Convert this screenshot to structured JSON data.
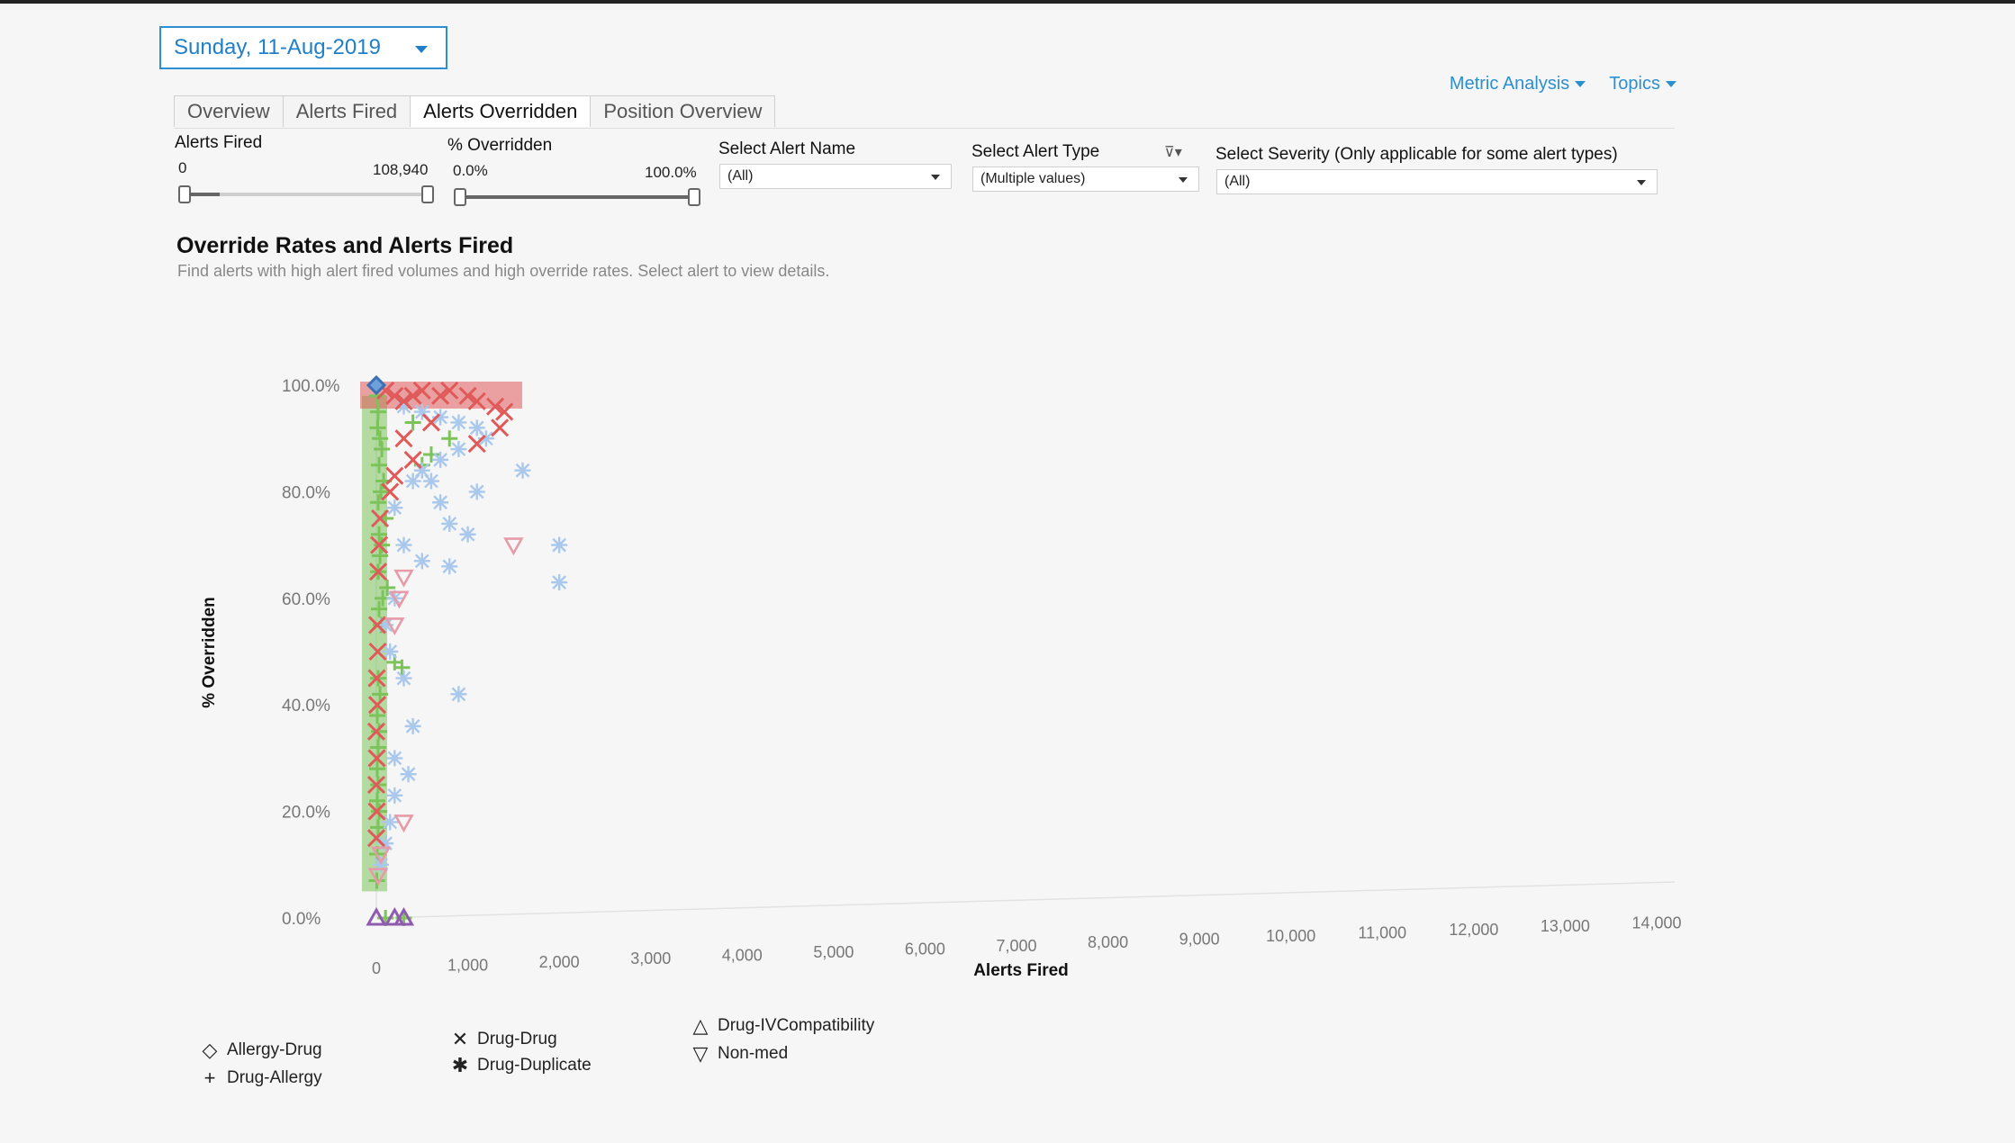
{
  "header": {
    "date_selector": "Sunday, 11-Aug-2019",
    "links": [
      {
        "label": "Metric Analysis"
      },
      {
        "label": "Topics"
      }
    ]
  },
  "tabs": [
    {
      "label": "Overview",
      "active": false
    },
    {
      "label": "Alerts Fired",
      "active": false
    },
    {
      "label": "Alerts Overridden",
      "active": true
    },
    {
      "label": "Position Overview",
      "active": false
    }
  ],
  "filters": {
    "alerts_fired": {
      "label": "Alerts Fired",
      "min": "0",
      "max": "108,940"
    },
    "pct_overridden": {
      "label": "% Overridden",
      "min": "0.0%",
      "max": "100.0%"
    },
    "alert_name": {
      "label": "Select Alert Name",
      "value": "(All)"
    },
    "alert_type": {
      "label": "Select Alert Type",
      "value": "(Multiple values)"
    },
    "severity": {
      "label": "Select Severity (Only applicable for some alert types)",
      "value": "(All)"
    }
  },
  "chart_data": {
    "type": "scatter",
    "title": "Override Rates and Alerts Fired",
    "subtitle": "Find alerts with high alert fired volumes and high override rates. Select alert to view details.",
    "xlabel": "Alerts Fired",
    "ylabel": "% Overridden",
    "xlim": [
      0,
      14000
    ],
    "ylim": [
      0,
      100
    ],
    "x_ticks": [
      "0",
      "1,000",
      "2,000",
      "3,000",
      "4,000",
      "5,000",
      "6,000",
      "7,000",
      "8,000",
      "9,000",
      "10,000",
      "11,000",
      "12,000",
      "13,000",
      "14,000"
    ],
    "y_ticks": [
      "0.0%",
      "20.0%",
      "40.0%",
      "60.0%",
      "80.0%",
      "100.0%"
    ],
    "colors": {
      "Allergy-Drug": "#3b6fb6",
      "Drug-Allergy": "#7cc35a",
      "Drug-Drug": "#e05a5a",
      "Drug-Duplicate": "#a9c8ec",
      "Drug-IVCompatibility": "#8e5bb0",
      "Non-med": "#e79aa8"
    },
    "series": [
      {
        "name": "Allergy-Drug",
        "marker": "diamond",
        "points": [
          [
            0,
            100
          ]
        ]
      },
      {
        "name": "Drug-Allergy",
        "marker": "plus",
        "points": [
          [
            10,
            98
          ],
          [
            20,
            95
          ],
          [
            15,
            92
          ],
          [
            40,
            90
          ],
          [
            60,
            88
          ],
          [
            30,
            85
          ],
          [
            80,
            82
          ],
          [
            50,
            80
          ],
          [
            20,
            78
          ],
          [
            100,
            75
          ],
          [
            30,
            72
          ],
          [
            60,
            70
          ],
          [
            40,
            68
          ],
          [
            20,
            65
          ],
          [
            120,
            62
          ],
          [
            70,
            60
          ],
          [
            30,
            58
          ],
          [
            50,
            55
          ],
          [
            200,
            48
          ],
          [
            280,
            47
          ],
          [
            20,
            45
          ],
          [
            40,
            42
          ],
          [
            10,
            38
          ],
          [
            30,
            35
          ],
          [
            20,
            32
          ],
          [
            10,
            28
          ],
          [
            20,
            25
          ],
          [
            10,
            22
          ],
          [
            30,
            20
          ],
          [
            20,
            17
          ],
          [
            10,
            12
          ],
          [
            5,
            7
          ],
          [
            100,
            0
          ],
          [
            300,
            0
          ],
          [
            500,
            85
          ],
          [
            800,
            90
          ],
          [
            400,
            93
          ],
          [
            600,
            87
          ]
        ]
      },
      {
        "name": "Drug-Drug",
        "marker": "x",
        "points": [
          [
            100,
            99
          ],
          [
            200,
            98
          ],
          [
            300,
            97
          ],
          [
            400,
            98
          ],
          [
            500,
            99
          ],
          [
            700,
            98
          ],
          [
            800,
            99
          ],
          [
            1000,
            98
          ],
          [
            1100,
            97
          ],
          [
            1300,
            96
          ],
          [
            1400,
            95
          ],
          [
            1350,
            92
          ],
          [
            600,
            93
          ],
          [
            300,
            90
          ],
          [
            400,
            86
          ],
          [
            200,
            83
          ],
          [
            150,
            80
          ],
          [
            1100,
            89
          ],
          [
            40,
            75
          ],
          [
            30,
            70
          ],
          [
            20,
            65
          ],
          [
            10,
            55
          ],
          [
            15,
            50
          ],
          [
            5,
            45
          ],
          [
            10,
            40
          ],
          [
            0,
            35
          ],
          [
            5,
            30
          ],
          [
            0,
            25
          ],
          [
            5,
            20
          ],
          [
            0,
            15
          ]
        ]
      },
      {
        "name": "Drug-Duplicate",
        "marker": "asterisk",
        "points": [
          [
            300,
            96
          ],
          [
            500,
            95
          ],
          [
            700,
            94
          ],
          [
            900,
            93
          ],
          [
            1100,
            92
          ],
          [
            1200,
            90
          ],
          [
            900,
            88
          ],
          [
            700,
            86
          ],
          [
            500,
            84
          ],
          [
            400,
            82
          ],
          [
            600,
            82
          ],
          [
            1100,
            80
          ],
          [
            1600,
            84
          ],
          [
            700,
            78
          ],
          [
            200,
            77
          ],
          [
            800,
            74
          ],
          [
            1000,
            72
          ],
          [
            300,
            70
          ],
          [
            500,
            67
          ],
          [
            800,
            66
          ],
          [
            2000,
            70
          ],
          [
            2000,
            63
          ],
          [
            200,
            60
          ],
          [
            100,
            55
          ],
          [
            150,
            50
          ],
          [
            300,
            45
          ],
          [
            900,
            42
          ],
          [
            400,
            36
          ],
          [
            200,
            30
          ],
          [
            350,
            27
          ],
          [
            200,
            23
          ],
          [
            150,
            18
          ],
          [
            100,
            14
          ],
          [
            50,
            10
          ]
        ]
      },
      {
        "name": "Drug-IVCompatibility",
        "marker": "triangle",
        "points": [
          [
            0,
            0
          ],
          [
            200,
            0
          ],
          [
            300,
            0
          ]
        ]
      },
      {
        "name": "Non-med",
        "marker": "triangle-down",
        "points": [
          [
            1500,
            70
          ],
          [
            300,
            64
          ],
          [
            250,
            60
          ],
          [
            200,
            55
          ],
          [
            300,
            18
          ],
          [
            50,
            12
          ],
          [
            20,
            8
          ]
        ]
      }
    ],
    "legend": [
      {
        "name": "Allergy-Drug",
        "symbol": "◇"
      },
      {
        "name": "Drug-Allergy",
        "symbol": "+"
      },
      {
        "name": "Drug-Drug",
        "symbol": "✕"
      },
      {
        "name": "Drug-Duplicate",
        "symbol": "✱"
      },
      {
        "name": "Drug-IVCompatibility",
        "symbol": "△"
      },
      {
        "name": "Non-med",
        "symbol": "▽"
      }
    ],
    "legend_position": "bottom-left",
    "grid": false
  }
}
